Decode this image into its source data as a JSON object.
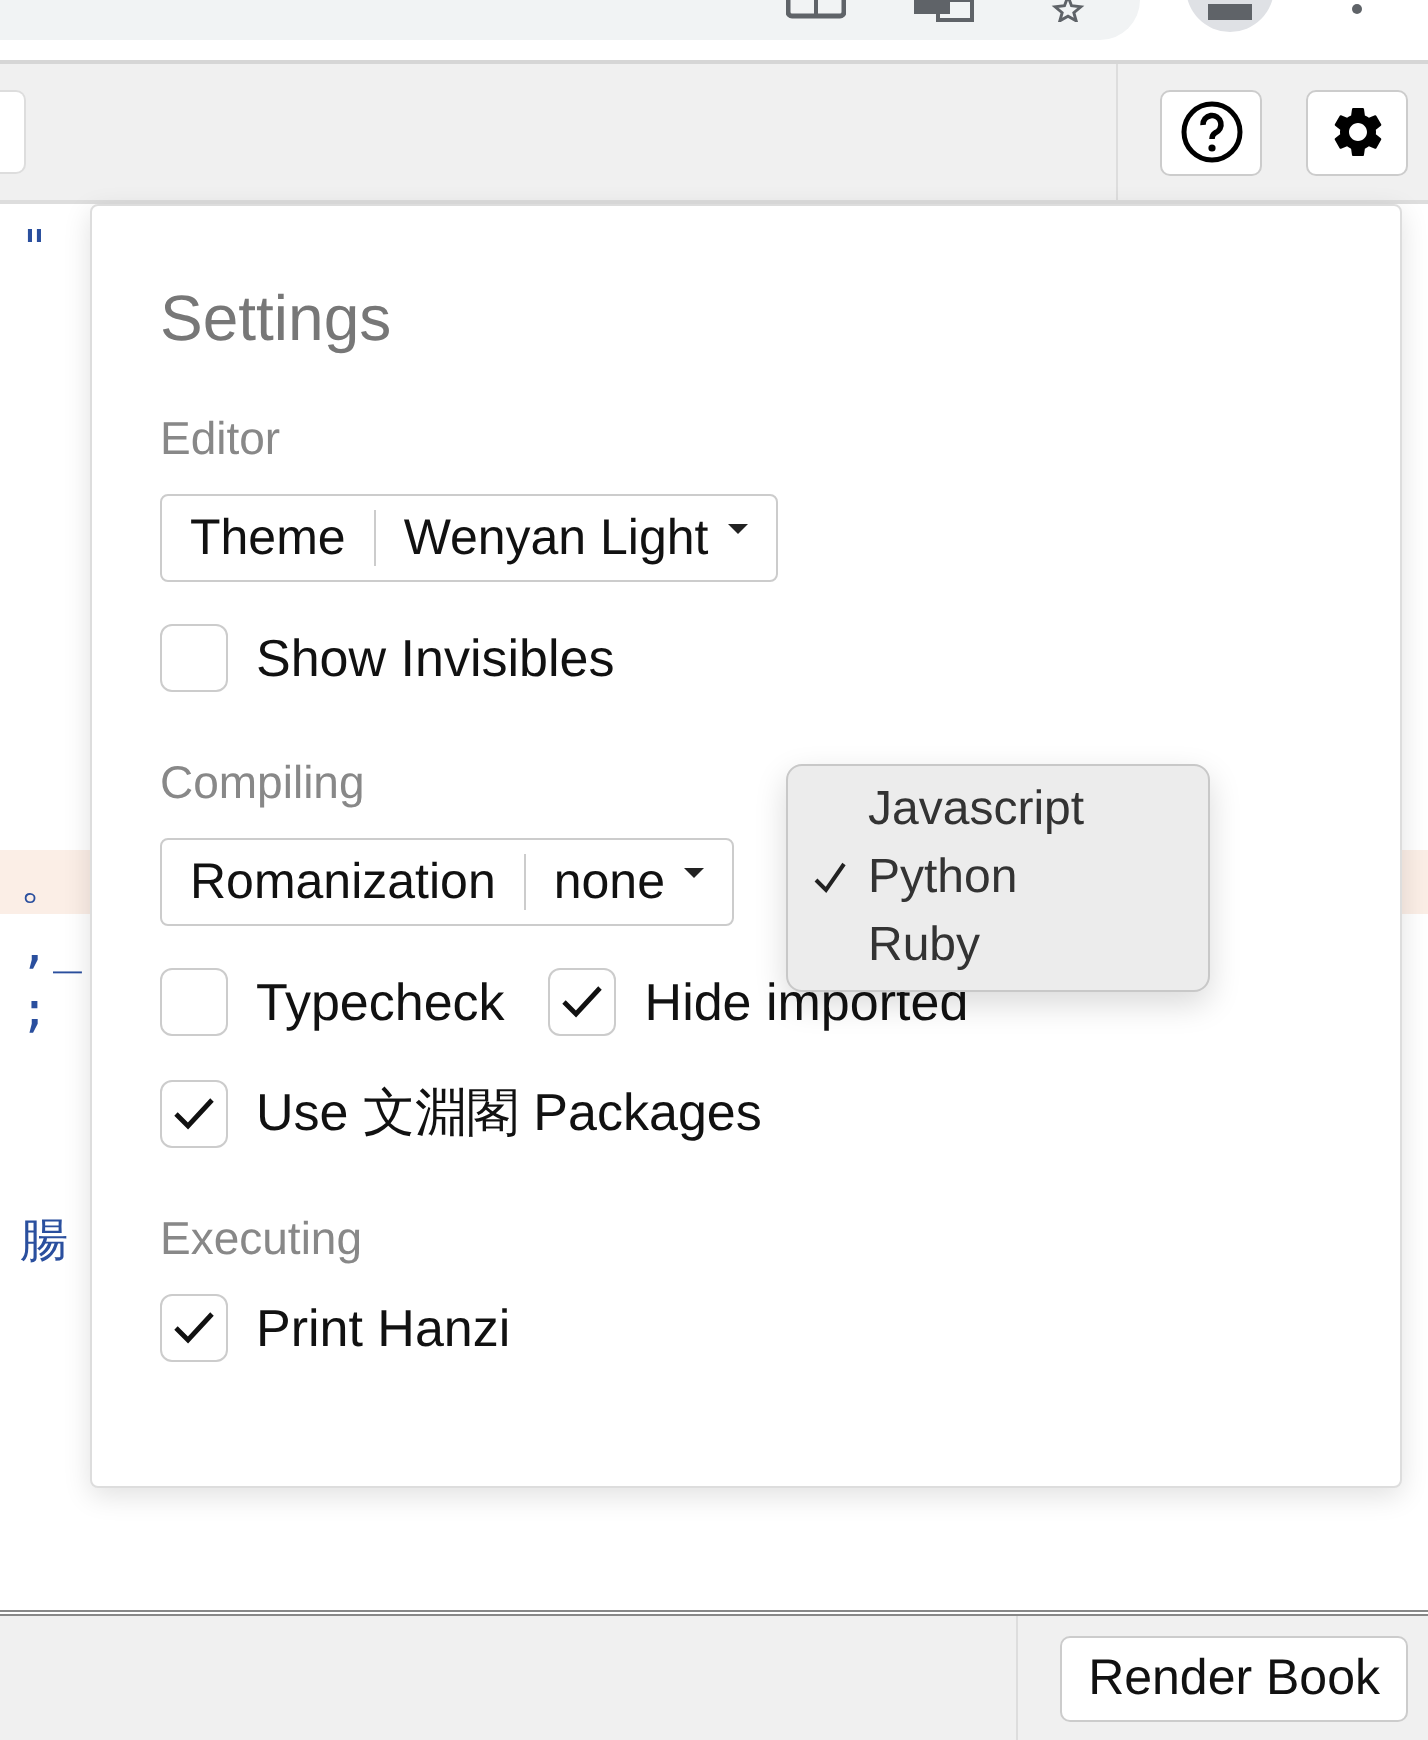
{
  "code_lines": [
    {
      "text": "\"",
      "highlighted": false
    },
    {
      "text": "。",
      "highlighted": true
    },
    {
      "text": ",_",
      "highlighted": false
    },
    {
      "text": ";",
      "highlighted": false
    },
    {
      "text": "腸",
      "highlighted": false
    }
  ],
  "settings": {
    "title": "Settings",
    "sections": [
      {
        "heading": "Editor",
        "rows": [
          {
            "kind": "select",
            "label": "Theme",
            "value": "Wenyan Light"
          },
          {
            "kind": "checkboxes",
            "items": [
              {
                "label": "Show Invisibles",
                "checked": false
              }
            ]
          }
        ]
      },
      {
        "heading": "Compiling",
        "rows": [
          {
            "kind": "select",
            "label": "Romanization",
            "value": "none"
          },
          {
            "kind": "checkboxes",
            "items": [
              {
                "label": "Typecheck",
                "checked": false
              },
              {
                "label": "Hide imported",
                "checked": true
              }
            ]
          },
          {
            "kind": "checkboxes",
            "items": [
              {
                "label": "Use 文淵閣 Packages",
                "checked": true
              }
            ]
          }
        ]
      },
      {
        "heading": "Executing",
        "rows": [
          {
            "kind": "checkboxes",
            "items": [
              {
                "label": "Print Hanzi",
                "checked": true
              }
            ]
          }
        ]
      }
    ]
  },
  "dropdown": {
    "items": [
      {
        "label": "Javascript",
        "selected": false
      },
      {
        "label": "Python",
        "selected": true
      },
      {
        "label": "Ruby",
        "selected": false
      }
    ]
  },
  "footer": {
    "button": "Render Book"
  }
}
